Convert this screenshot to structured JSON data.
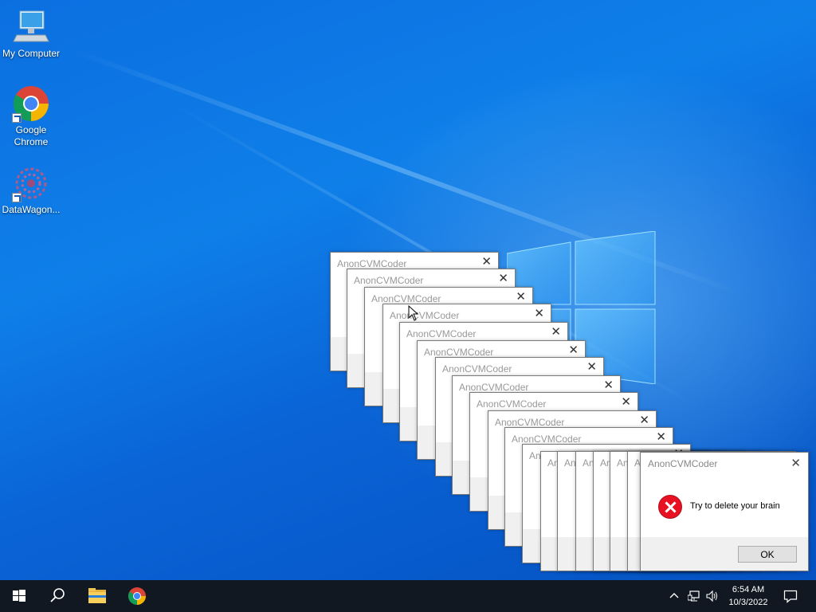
{
  "desktop": {
    "icons": [
      {
        "label": "My Computer"
      },
      {
        "label": "Google\nChrome"
      },
      {
        "label": "DataWagon..."
      }
    ]
  },
  "dialogs": {
    "title": "AnonCVMCoder",
    "close_glyph": "✕"
  },
  "main_dialog": {
    "title": "AnonCVMCoder",
    "message": "Try to delete your brain",
    "ok_label": "OK",
    "close_glyph": "✕"
  },
  "taskbar": {
    "time": "6:54 AM",
    "date": "10/3/2022"
  },
  "colors": {
    "taskbar": "#111821",
    "error": "#e81123",
    "desktop": "#0a6ad8"
  }
}
